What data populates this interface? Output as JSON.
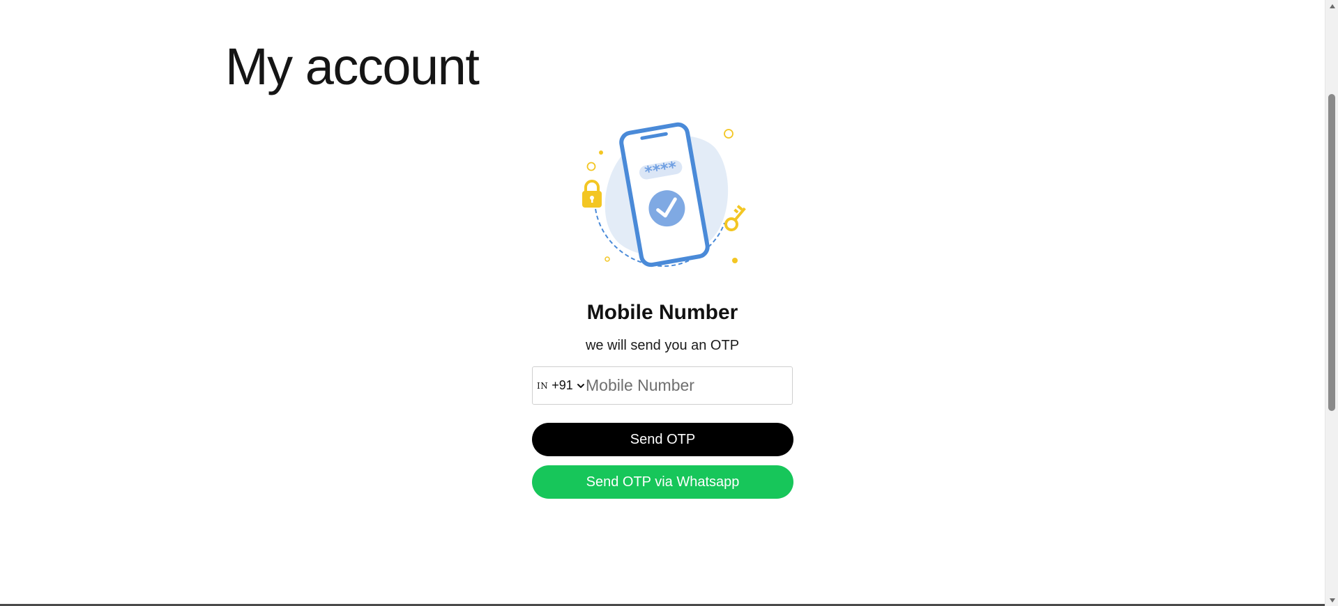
{
  "page": {
    "title": "My account"
  },
  "illustration": {
    "masked_digits": "****",
    "icons": [
      "phone-icon",
      "check-icon",
      "lock-icon",
      "key-icon"
    ],
    "colors": {
      "phone_blue": "#4a8ad8",
      "blob": "#e3ecf7",
      "check_circle": "#7fa9e3",
      "accent_yellow": "#f3c623"
    }
  },
  "form": {
    "heading": "Mobile Number",
    "subtitle": "we will send you an OTP",
    "country": {
      "code": "IN",
      "dial_code": "+91"
    },
    "mobile_input": {
      "value": "",
      "placeholder": "Mobile Number"
    },
    "send_otp_label": "Send OTP",
    "send_whatsapp_label": "Send OTP via Whatsapp"
  },
  "colors": {
    "primary_button": "#000000",
    "whatsapp_button": "#17c65a",
    "button_text": "#ffffff"
  }
}
